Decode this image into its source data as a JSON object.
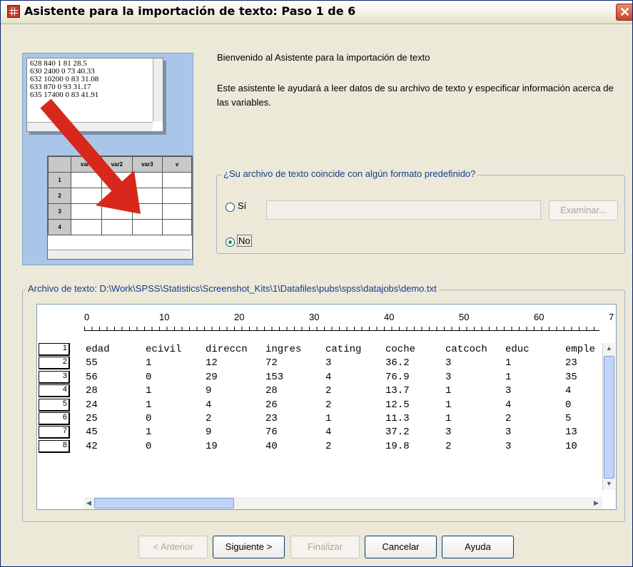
{
  "window": {
    "title": "Asistente para la importación de texto: Paso 1 de 6",
    "close_glyph": "✕"
  },
  "illustration": {
    "text_lines": [
      "628 840 1 81 28.5",
      "630 2400 0 73 40.33",
      "632 10200 0 83 31.08",
      "633 870 0 93 31.17",
      "635 17400 0 83 41.91"
    ],
    "grid_columns": [
      "var1",
      "var2",
      "var3",
      "v"
    ],
    "grid_rows": [
      "1",
      "2",
      "3",
      "4"
    ]
  },
  "intro": {
    "welcome": "Bienvenido al Asistente para la importación de texto",
    "description": "Este asistente le ayudará a leer datos de su archivo de texto y especificar información acerca de las variables."
  },
  "format_group": {
    "legend": "¿Su archivo de texto coincide con algún formato predefinido?",
    "yes_label": "Sí",
    "no_label": "No",
    "selected": "No",
    "browse_label": "Examinar..."
  },
  "file_group": {
    "legend": "Archivo de texto:  D:\\Work\\SPSS\\Statistics\\Screenshot_Kits\\1\\Datafiles\\pubs\\spss\\datajobs\\demo.txt"
  },
  "ruler": [
    "0",
    "10",
    "20",
    "30",
    "40",
    "50",
    "60",
    "7"
  ],
  "preview_rows": [
    {
      "n": "1",
      "cols": [
        "edad",
        "ecivil",
        "direccn",
        "ingres",
        "cating",
        "coche",
        "catcoch",
        "educ",
        "emple"
      ]
    },
    {
      "n": "2",
      "cols": [
        "55",
        "1",
        "12",
        "72",
        "3",
        "36.2",
        "3",
        "1",
        "23"
      ]
    },
    {
      "n": "3",
      "cols": [
        "56",
        "0",
        "29",
        "153",
        "4",
        "76.9",
        "3",
        "1",
        "35"
      ]
    },
    {
      "n": "4",
      "cols": [
        "28",
        "1",
        "9",
        "28",
        "2",
        "13.7",
        "1",
        "3",
        "4"
      ]
    },
    {
      "n": "5",
      "cols": [
        "24",
        "1",
        "4",
        "26",
        "2",
        "12.5",
        "1",
        "4",
        "0"
      ]
    },
    {
      "n": "6",
      "cols": [
        "25",
        "0",
        "2",
        "23",
        "1",
        "11.3",
        "1",
        "2",
        "5"
      ]
    },
    {
      "n": "7",
      "cols": [
        "45",
        "1",
        "9",
        "76",
        "4",
        "37.2",
        "3",
        "3",
        "13"
      ]
    },
    {
      "n": "8",
      "cols": [
        "42",
        "0",
        "19",
        "40",
        "2",
        "19.8",
        "2",
        "3",
        "10"
      ]
    }
  ],
  "buttons": {
    "back": "< Anterior",
    "next": "Siguiente >",
    "finish": "Finalizar",
    "cancel": "Cancelar",
    "help": "Ayuda"
  }
}
